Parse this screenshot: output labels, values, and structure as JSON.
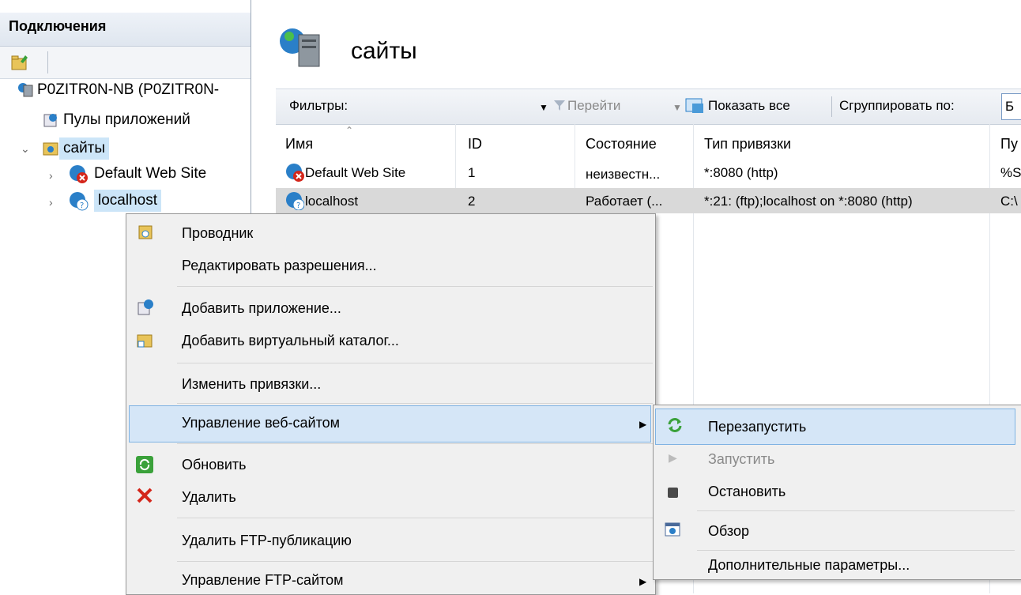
{
  "left_panel": {
    "title": "Подключения",
    "tree": {
      "server": "P0ZITR0N-NB (P0ZITR0N-",
      "app_pools": "Пулы приложений",
      "sites": "сайты",
      "site1": "Default Web Site",
      "site2": "localhost"
    }
  },
  "main": {
    "title": "сайты",
    "filter": {
      "label": "Фильтры:",
      "go": "Перейти",
      "show_all": "Показать все",
      "group_by": "Сгруппировать по:",
      "group_value": "Б"
    },
    "table": {
      "headers": [
        "Имя",
        "ID",
        "Состояние",
        "Тип привязки",
        "Пу"
      ],
      "rows": [
        {
          "name": "Default Web Site",
          "id": "1",
          "state": "неизвестн...",
          "binding": "*:8080 (http)",
          "path": "%S"
        },
        {
          "name": "localhost",
          "id": "2",
          "state": "Работает (...",
          "binding": "*:21: (ftp);localhost on *:8080 (http)",
          "path": "C:\\"
        }
      ]
    }
  },
  "context_menu": {
    "items": [
      "Проводник",
      "Редактировать разрешения...",
      "Добавить приложение...",
      "Добавить виртуальный каталог...",
      "Изменить привязки...",
      "Управление веб-сайтом",
      "Обновить",
      "Удалить",
      "Удалить FTP-публикацию",
      "Управление FTP-сайтом"
    ]
  },
  "submenu": {
    "items": [
      "Перезапустить",
      "Запустить",
      "Остановить",
      "Обзор",
      "Дополнительные параметры..."
    ]
  },
  "colors": {
    "highlight": "#d5e6f7",
    "selection": "#cce5f8",
    "delete_red": "#d4261b",
    "refresh_green": "#3aa13a"
  }
}
